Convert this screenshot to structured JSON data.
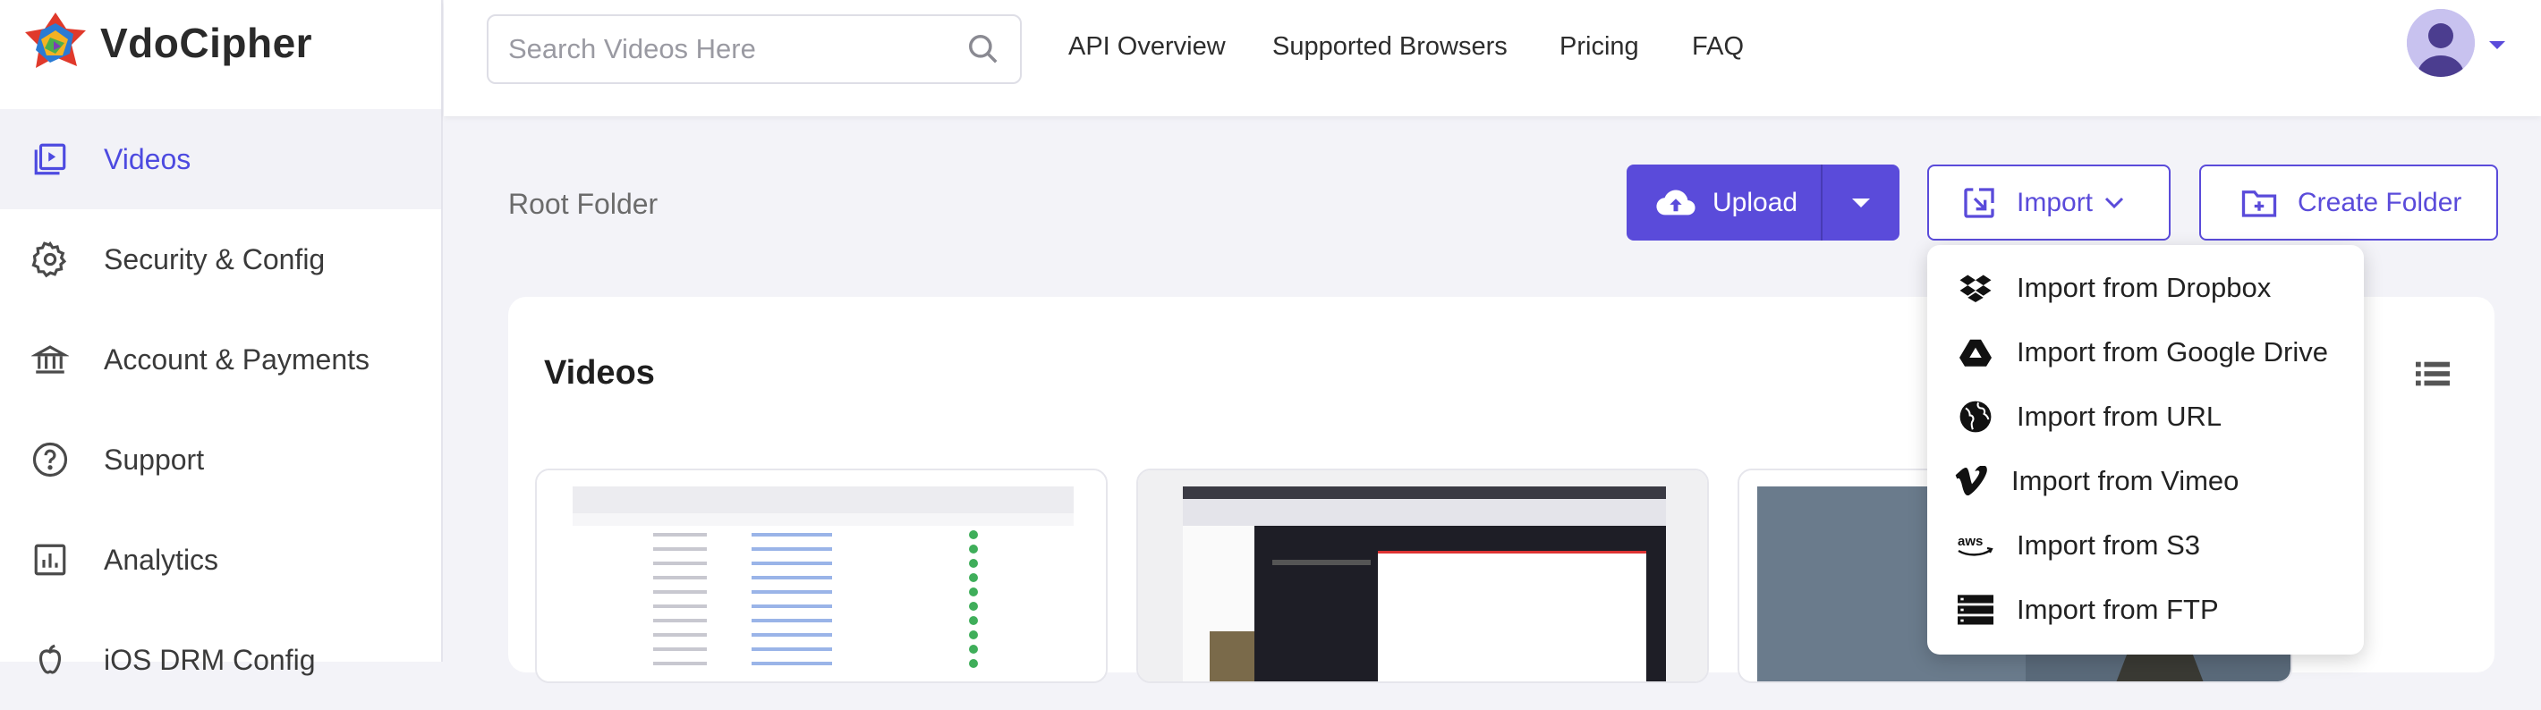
{
  "brand": {
    "name": "VdoCipher"
  },
  "sidebar": {
    "items": [
      {
        "label": "Videos",
        "icon": "video-library-icon",
        "active": true
      },
      {
        "label": "Security & Config",
        "icon": "gear-icon",
        "active": false
      },
      {
        "label": "Account & Payments",
        "icon": "bank-icon",
        "active": false
      },
      {
        "label": "Support",
        "icon": "help-circle-icon",
        "active": false
      },
      {
        "label": "Analytics",
        "icon": "analytics-icon",
        "active": false
      },
      {
        "label": "iOS DRM Config",
        "icon": "apple-icon",
        "active": false
      }
    ]
  },
  "header": {
    "search": {
      "placeholder": "Search Videos Here",
      "value": ""
    },
    "nav": [
      "API Overview",
      "Supported Browsers",
      "Pricing",
      "FAQ"
    ]
  },
  "main": {
    "breadcrumb": "Root Folder",
    "upload_label": "Upload",
    "import_label": "Import",
    "create_folder_label": "Create Folder",
    "section_title": "Videos"
  },
  "import_menu": {
    "items": [
      {
        "label": "Import from Dropbox",
        "icon": "dropbox-icon"
      },
      {
        "label": "Import from Google Drive",
        "icon": "google-drive-icon"
      },
      {
        "label": "Import from URL",
        "icon": "globe-icon"
      },
      {
        "label": "Import from Vimeo",
        "icon": "vimeo-icon"
      },
      {
        "label": "Import from S3",
        "icon": "aws-icon"
      },
      {
        "label": "Import from FTP",
        "icon": "ftp-server-icon"
      }
    ]
  },
  "colors": {
    "accent": "#5a4bda",
    "active_nav_text": "#4d4ae0"
  }
}
